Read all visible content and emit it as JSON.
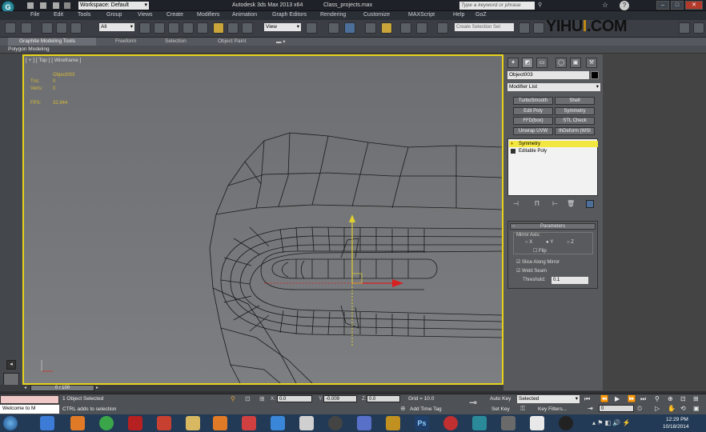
{
  "titlebar": {
    "workspace": "Workspace: Default",
    "app_title": "Autodesk 3ds Max  2013 x64",
    "file_name": "Class_projects.max",
    "search_placeholder": "Type a keyword or phrase"
  },
  "menu": [
    "File",
    "Edit",
    "Tools",
    "Group",
    "Views",
    "Create",
    "Modifiers",
    "Animation",
    "Graph Editors",
    "Rendering",
    "Customize",
    "MAXScript",
    "Help",
    "GoZ"
  ],
  "toolbar": {
    "selection_filter": "All",
    "ref_coord": "View",
    "selection_set_placeholder": "Create Selection Set"
  },
  "watermark": {
    "part1": "YIHU",
    "part2": "I",
    "part3": ".COM"
  },
  "ribbon": {
    "tabs": [
      "Graphite Modeling Tools",
      "Freeform",
      "Selection",
      "Object Paint"
    ],
    "subtab": "Polygon Modeling"
  },
  "viewport": {
    "label": "[ + ] [ Top ] [ Wireframe ]",
    "object_name": "Object003",
    "tris_label": "Tris:",
    "tris_value": "0",
    "verts_label": "Verts:",
    "verts_value": "0",
    "fps_label": "FPS:",
    "fps_value": "32.944"
  },
  "command_panel": {
    "object_name": "Object003",
    "modifier_list": "Modifier List",
    "buttons": [
      [
        "TurboSmooth",
        "Shell"
      ],
      [
        "Edit Poly",
        "Symmetry"
      ],
      [
        "FFD(box)",
        "STL Check"
      ],
      [
        "Unwrap UVW",
        "thDeform (WSI"
      ]
    ],
    "stack": [
      "Symmetry",
      "Editable Poly"
    ],
    "params_title": "Parameters",
    "mirror_axis_label": "Mirror Axis:",
    "axes": [
      "X",
      "Y",
      "Z"
    ],
    "selected_axis": "Y",
    "flip_label": "Flip",
    "slice_label": "Slice Along Mirror",
    "weld_label": "Weld Seam",
    "threshold_label": "Threshold:",
    "threshold_value": "0.1"
  },
  "timeline": {
    "position": "0 / 100"
  },
  "status": {
    "selection": "1 Object Selected",
    "prompt": "CTRL adds to selection",
    "welcome": "Welcome to M",
    "x_label": "X:",
    "x_value": "0.0",
    "y_label": "Y:",
    "y_value": "-0.009",
    "z_label": "Z:",
    "z_value": "0.0",
    "grid": "Grid = 10.0",
    "add_time_tag": "Add Time Tag",
    "auto_key": "Auto Key",
    "set_key": "Set Key",
    "selected_dropdown": "Selected",
    "key_filters": "Key Filters...",
    "frame_value": "0"
  },
  "taskbar": {
    "time": "12:29 PM",
    "date": "10/18/2014"
  },
  "colors": {
    "viewport_border": "#e6d21b",
    "stack_highlight": "#f2e640",
    "gizmo_x": "#d82020",
    "gizmo_y": "#e0d030"
  }
}
